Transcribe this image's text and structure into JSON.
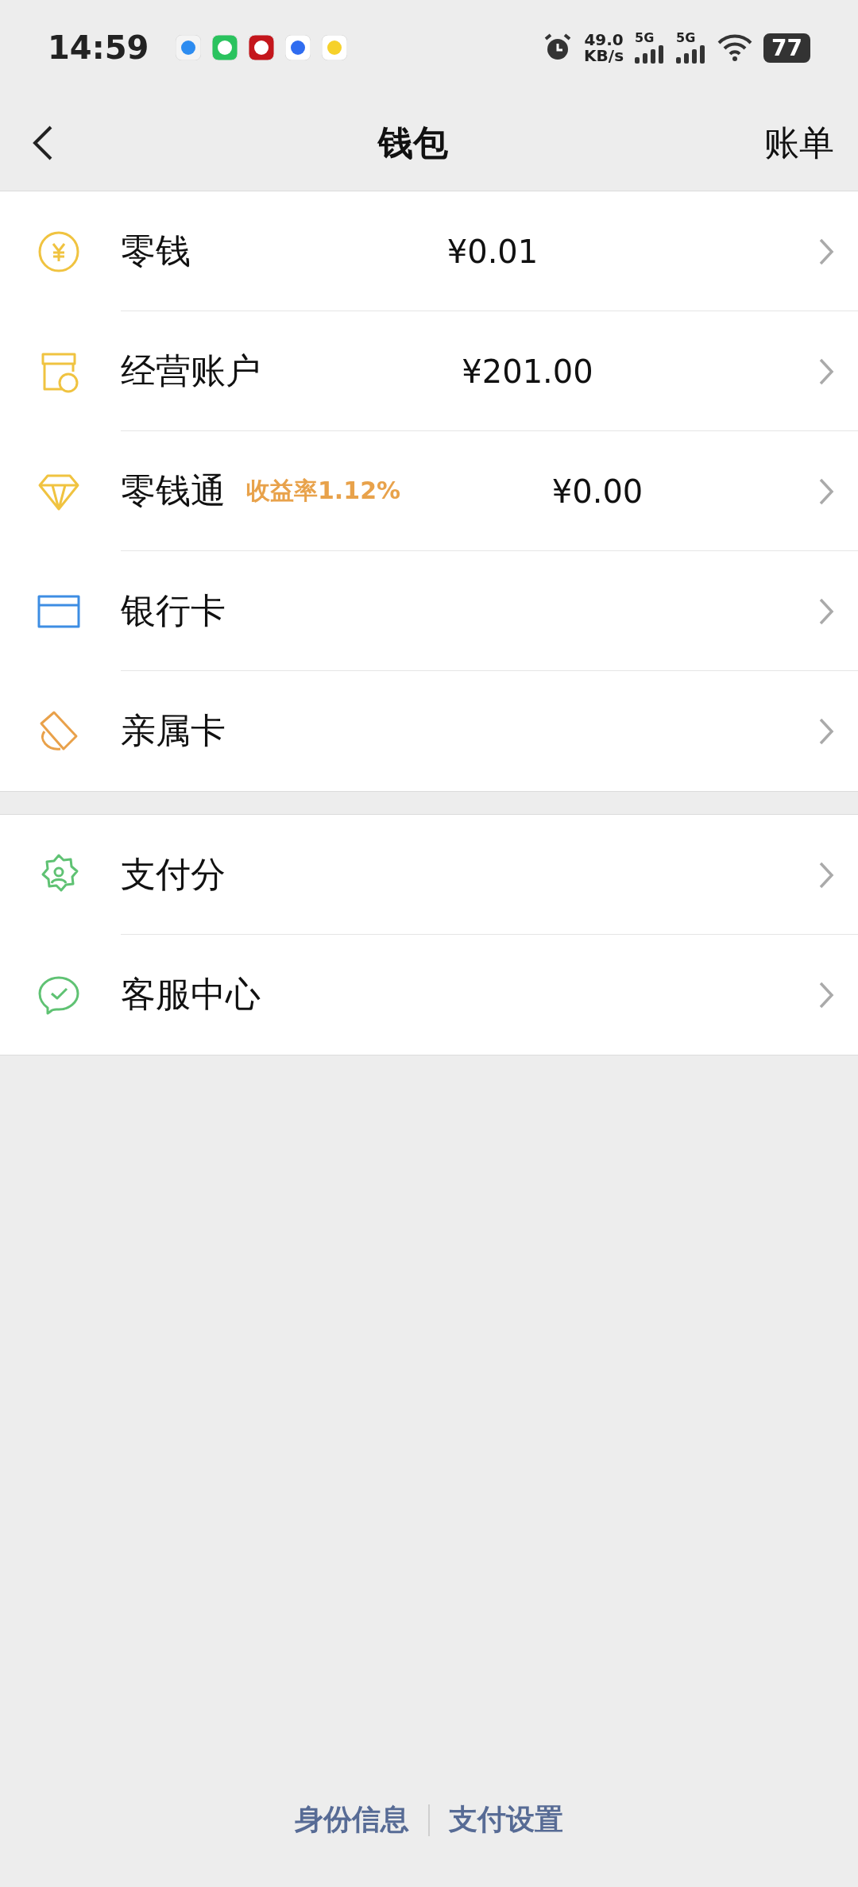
{
  "status_bar": {
    "time": "14:59",
    "net_speed": "49.0",
    "net_unit": "KB/s",
    "sim": [
      "5G",
      "5G"
    ],
    "battery": "77"
  },
  "nav": {
    "title": "钱包",
    "action": "账单"
  },
  "groups": [
    {
      "items": [
        {
          "label": "零钱",
          "value": "¥0.01"
        },
        {
          "label": "经营账户",
          "value": "¥201.00"
        },
        {
          "label": "零钱通",
          "badge": "收益率1.12%",
          "value": "¥0.00"
        },
        {
          "label": "银行卡"
        },
        {
          "label": "亲属卡"
        }
      ]
    },
    {
      "items": [
        {
          "label": "支付分"
        },
        {
          "label": "客服中心"
        }
      ]
    }
  ],
  "footer": [
    "身份信息",
    "支付设置"
  ]
}
